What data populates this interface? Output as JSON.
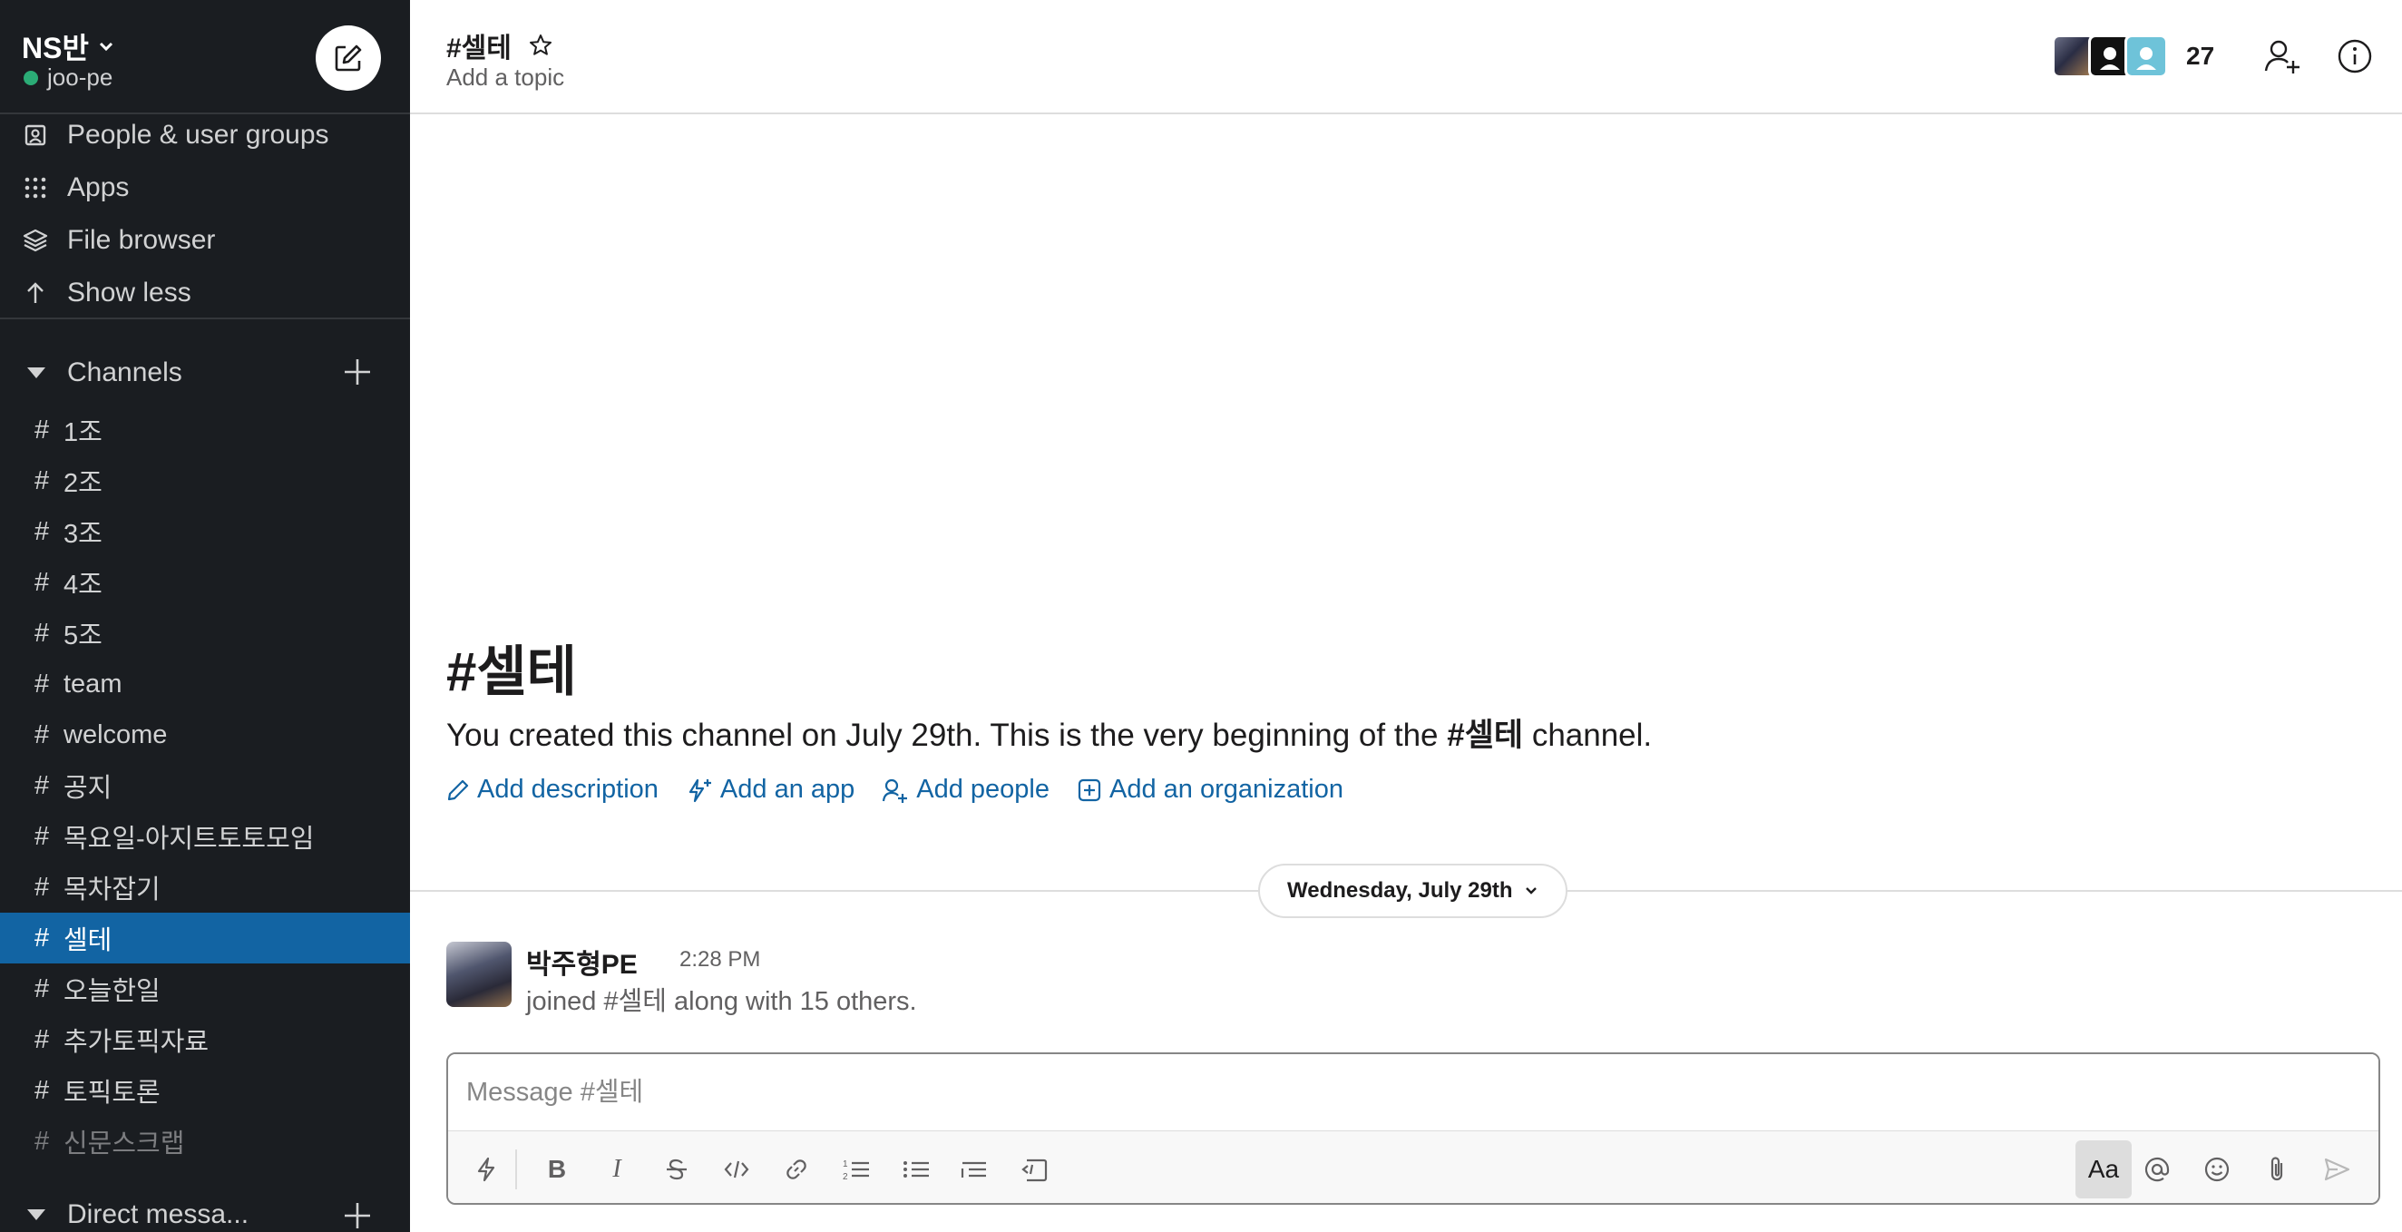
{
  "workspace": {
    "name": "NS반",
    "user": "joo-pe"
  },
  "sidebar": {
    "nav_items": [
      {
        "label": "People & user groups",
        "icon": "people-icon"
      },
      {
        "label": "Apps",
        "icon": "apps-grid-icon"
      },
      {
        "label": "File browser",
        "icon": "layers-icon"
      },
      {
        "label": "Show less",
        "icon": "arrow-up-icon"
      }
    ],
    "channels_label": "Channels",
    "channels": [
      "1조",
      "2조",
      "3조",
      "4조",
      "5조",
      "team",
      "welcome",
      "공지",
      "목요일-아지트토토모임",
      "목차잡기",
      "셀테",
      "오늘한일",
      "추가토픽자료",
      "토픽토론",
      "신문스크랩"
    ],
    "active_channel": "셀테",
    "muted_channel": "신문스크랩",
    "hash": "#",
    "dm_label": "Direct messa..."
  },
  "header": {
    "channel_title": "#셀테",
    "topic_placeholder": "Add a topic",
    "member_count": "27"
  },
  "intro": {
    "title": "#셀테",
    "text_before": "You created this channel on July 29th. This is the very beginning of the ",
    "text_channel": "#셀테",
    "text_after": " channel.",
    "actions": [
      "Add description",
      "Add an app",
      "Add people",
      "Add an organization"
    ]
  },
  "date_divider": "Wednesday, July 29th",
  "message": {
    "author": "박주형PE",
    "time": "2:28 PM",
    "text": "joined #셀테 along with 15 others."
  },
  "composer": {
    "placeholder": "Message #셀테",
    "format_label": "Aa"
  },
  "colors": {
    "sidebar_bg": "#1a1d21",
    "active_channel_bg": "#1264a3",
    "link": "#1264a3",
    "presence": "#2bac76"
  }
}
